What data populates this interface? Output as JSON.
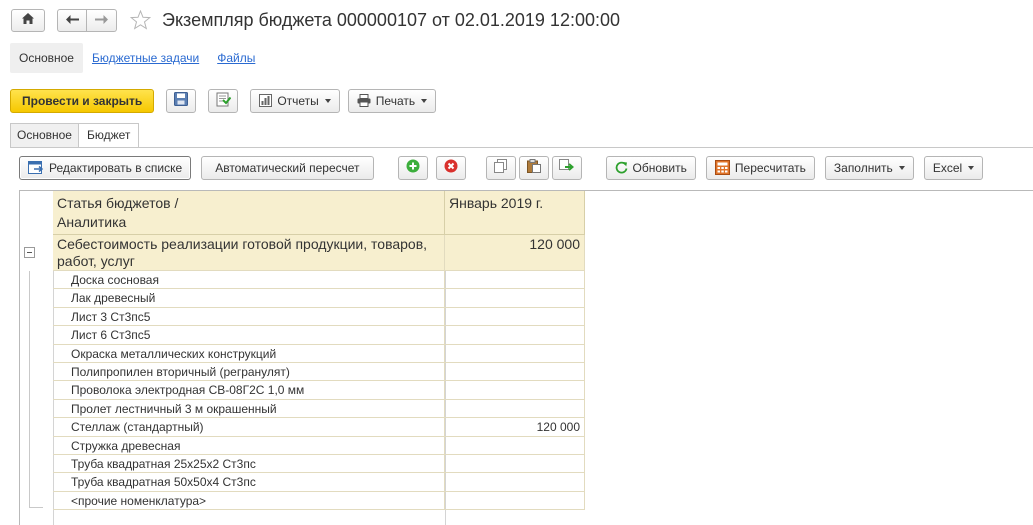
{
  "window": {
    "title": "Экземпляр бюджета 000000107 от 02.01.2019 12:00:00"
  },
  "section_links": [
    {
      "label": "Основное",
      "active": true
    },
    {
      "label": "Бюджетные задачи",
      "active": false
    },
    {
      "label": "Файлы",
      "active": false
    }
  ],
  "toolbar": {
    "post_close_label": "Провести и закрыть",
    "reports_label": "Отчеты",
    "print_label": "Печать"
  },
  "tabs": [
    {
      "label": "Основное",
      "active": false
    },
    {
      "label": "Бюджет",
      "active": true
    }
  ],
  "table_toolbar": {
    "edit_in_list_label": "Редактировать в списке",
    "auto_recalc_label": "Автоматический пересчет",
    "refresh_label": "Обновить",
    "recalc_label": "Пересчитать",
    "fill_label": "Заполнить",
    "excel_label": "Excel"
  },
  "table": {
    "header_item": "Статья бюджетов /\nАналитика",
    "header_item_line1": "Статья бюджетов /",
    "header_item_line2": "Аналитика",
    "header_period": "Январь 2019 г.",
    "group": {
      "name": "Себестоимость реализации готовой продукции, товаров, работ, услуг",
      "value": "120 000"
    },
    "rows": [
      {
        "name": "Доска сосновая",
        "value": ""
      },
      {
        "name": "Лак древесный",
        "value": ""
      },
      {
        "name": "Лист 3 Ст3пс5",
        "value": ""
      },
      {
        "name": "Лист 6 Ст3пс5",
        "value": ""
      },
      {
        "name": "Окраска металлических конструкций",
        "value": ""
      },
      {
        "name": "Полипропилен вторичный (регранулят)",
        "value": ""
      },
      {
        "name": "Проволока электродная СВ-08Г2С 1,0 мм",
        "value": ""
      },
      {
        "name": "Пролет лестничный 3 м окрашенный",
        "value": ""
      },
      {
        "name": "Стеллаж (стандартный)",
        "value": "120 000"
      },
      {
        "name": "Стружка древесная",
        "value": ""
      },
      {
        "name": "Труба квадратная 25х25х2 Ст3пс",
        "value": ""
      },
      {
        "name": "Труба квадратная 50х50х4 Ст3пс",
        "value": ""
      },
      {
        "name": "<прочие номенклатура>",
        "value": ""
      }
    ]
  },
  "colors": {
    "primary_button": "#f6c800",
    "link": "#2a6ad1",
    "header_bg": "#f7efcf",
    "add_icon": "#3cae3c",
    "delete_icon": "#d9302c"
  }
}
